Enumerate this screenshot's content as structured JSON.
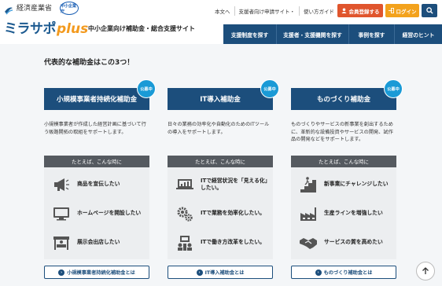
{
  "header": {
    "ministry": "経済産業省",
    "badge": "中小企業庁",
    "logo_main": "ミラサポ",
    "logo_plus": "plus",
    "logo_sub": "中小企業向け補助金・総合支援サイト"
  },
  "topnav": [
    "本文へ",
    "支援者向け申請サイト・",
    "使い方ガイド"
  ],
  "buttons": {
    "register": "会員登録する",
    "login": "ログイン"
  },
  "mainnav": [
    "支援制度を探す",
    "支援者・支援機関を探す",
    "事例を探す",
    "経営のヒント"
  ],
  "section_title": "代表的な補助金はこの3つ！",
  "badge_label": "公募中",
  "example_header": "たとえば、こんな時に",
  "cards": [
    {
      "title": "小規模事業者持続化補助金",
      "desc": "小規模事業者が作成した経営計画に基づいて行う販路開拓の取組をサポートします。",
      "items": [
        "商品を宣伝したい",
        "ホームページを開設したい",
        "展示会出店したい"
      ],
      "link": "小規模事業者持続化補助金とは"
    },
    {
      "title": "IT導入補助金",
      "desc": "日々の業務の効率化や自動化のためのITツールの導入をサポートします。",
      "items": [
        "ITで経営状況を「見える化」したい。",
        "ITで業務を効率化したい。",
        "ITで働き方改革をしたい。"
      ],
      "link": "IT導入補助金とは"
    },
    {
      "title": "ものづくり補助金",
      "desc": "ものづくりやサービスの新事業を創出するために、革新的な設備投資やサービスの開発、試作品の開発などをサポートします。",
      "items": [
        "新事業にチャレンジしたい",
        "生産ラインを増強したい",
        "サービスの質を高めたい"
      ],
      "link": "ものづくり補助金とは"
    }
  ]
}
